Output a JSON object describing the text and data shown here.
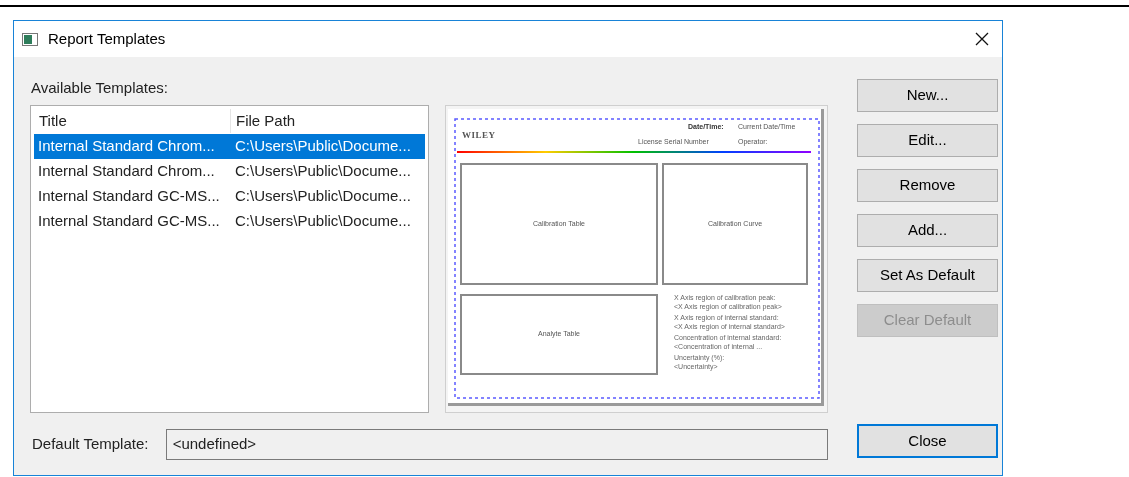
{
  "window": {
    "title": "Report Templates"
  },
  "templates": {
    "label": "Available Templates:",
    "columns": [
      "Title",
      "File Path"
    ],
    "rows": [
      {
        "title": "Internal Standard Chrom...",
        "path": "C:\\Users\\Public\\Docume...",
        "selected": true
      },
      {
        "title": "Internal Standard Chrom...",
        "path": "C:\\Users\\Public\\Docume...",
        "selected": false
      },
      {
        "title": "Internal Standard GC-MS...",
        "path": "C:\\Users\\Public\\Docume...",
        "selected": false
      },
      {
        "title": "Internal Standard GC-MS...",
        "path": "C:\\Users\\Public\\Docume...",
        "selected": false
      }
    ]
  },
  "preview": {
    "logo": "WILEY",
    "date_label": "Date/Time:",
    "date_value": "Current Date/Time",
    "license": "License Serial Number",
    "operator": "Operator:",
    "panels": [
      "Calibration Table",
      "Calibration Curve",
      "Analyte Table"
    ],
    "fields": [
      "X Axis region of calibration peak:",
      "<X Axis region of calibration peak>",
      "X Axis region of internal standard:",
      "<X Axis region of internal standard>",
      "Concentration of internal standard:",
      "<Concentration of internal ...",
      "Uncertainty (%):",
      "<Uncertainty>"
    ]
  },
  "buttons": [
    {
      "label": "New...",
      "disabled": false
    },
    {
      "label": "Edit...",
      "disabled": false
    },
    {
      "label": "Remove",
      "disabled": false
    },
    {
      "label": "Add...",
      "disabled": false
    },
    {
      "label": "Set As Default",
      "disabled": false
    },
    {
      "label": "Clear Default",
      "disabled": true
    }
  ],
  "default_template": {
    "label": "Default Template:",
    "value": "<undefined>"
  },
  "close_button": "Close"
}
